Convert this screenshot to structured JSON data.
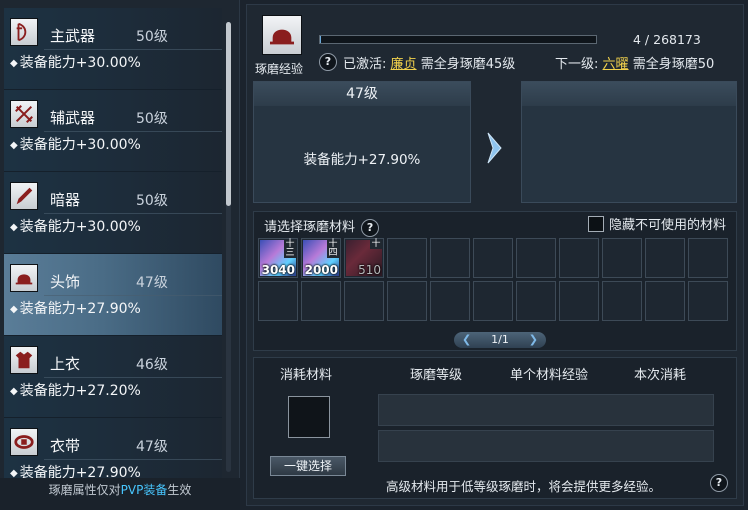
{
  "equipment_slots": [
    {
      "name": "主武器",
      "level": "50级",
      "bonus": "装备能力+30.00%",
      "icon": "bow-icon",
      "active": false
    },
    {
      "name": "辅武器",
      "level": "50级",
      "bonus": "装备能力+30.00%",
      "icon": "crossed-swords-icon",
      "active": false
    },
    {
      "name": "暗器",
      "level": "50级",
      "bonus": "装备能力+30.00%",
      "icon": "dart-icon",
      "active": false
    },
    {
      "name": "头饰",
      "level": "47级",
      "bonus": "装备能力+27.90%",
      "icon": "helmet-icon",
      "active": true
    },
    {
      "name": "上衣",
      "level": "46级",
      "bonus": "装备能力+27.20%",
      "icon": "robe-icon",
      "active": false
    },
    {
      "name": "衣带",
      "level": "47级",
      "bonus": "装备能力+27.90%",
      "icon": "belt-icon",
      "active": false
    }
  ],
  "footer": {
    "text_before": "琢磨属性仅对",
    "highlight": "PVP装备",
    "text_after": "生效",
    "highlight_color": "#48c7ff"
  },
  "header": {
    "label": "琢磨经验",
    "exp_text": "4 / 268173",
    "exp_current": 4,
    "exp_max": 268173,
    "activated_label": "已激活:",
    "activated_name": "廉贞",
    "activated_req": "需全身琢磨45级",
    "next_label": "下一级:",
    "next_name": "六曜",
    "next_req": "需全身琢磨50",
    "icon": "helmet-icon"
  },
  "current_level": {
    "level": "47级",
    "stat": "装备能力+27.90%"
  },
  "next_level": {
    "level": "",
    "stat": ""
  },
  "materials": {
    "title": "请选择琢磨材料",
    "hide_label": "隐藏不可使用的材料",
    "hide_checked": false,
    "items": [
      {
        "qty": "3040",
        "tag": "十三",
        "usable": true,
        "icon": "jade-material-icon"
      },
      {
        "qty": "2000",
        "tag": "十四",
        "usable": true,
        "icon": "jade-material-icon"
      },
      {
        "qty": "510",
        "tag": "十",
        "usable": false,
        "icon": "jade-material-icon"
      }
    ],
    "page": "1/1",
    "total_cells": 22
  },
  "consume": {
    "col_material": "消耗材料",
    "col_level": "琢磨等级",
    "col_exp": "单个材料经验",
    "col_cost": "本次消耗",
    "one_click": "一键选择",
    "hint": "高级材料用于低等级琢磨时，将会提供更多经验。"
  },
  "colors": {
    "gold": "#f2d24c",
    "accent_blue": "#48c7ff",
    "active_slot": "#5a7d98"
  }
}
